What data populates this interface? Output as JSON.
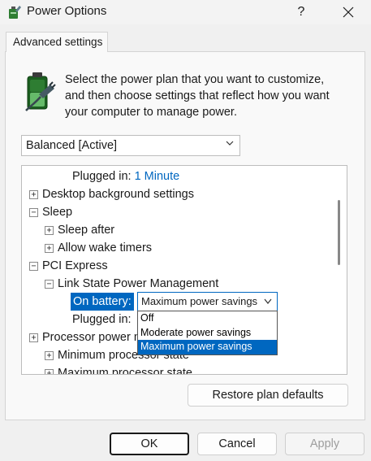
{
  "window": {
    "title": "Power Options",
    "help_label": "?",
    "close_label": "✕"
  },
  "tab": {
    "label": "Advanced settings"
  },
  "intro_text": "Select the power plan that you want to customize, and then choose settings that reflect how you want your computer to manage power.",
  "plan_select": {
    "value": "Balanced [Active]"
  },
  "tree": {
    "plugged_in_label": "Plugged in:",
    "plugged_in_value": "1 Minute",
    "desktop_background": "Desktop background settings",
    "sleep": "Sleep",
    "sleep_after": "Sleep after",
    "allow_wake_timers": "Allow wake timers",
    "pci_express": "PCI Express",
    "link_state": "Link State Power Management",
    "on_battery_label": "On battery:",
    "on_battery_value": "Maximum power savings",
    "plugged_in2_label": "Plugged in:",
    "processor_power": "Processor power m",
    "min_processor": "Minimum processor state",
    "max_processor": "Maximum processor state"
  },
  "dropdown": {
    "options": [
      "Off",
      "Moderate power savings",
      "Maximum power savings"
    ],
    "selected_index": 2
  },
  "buttons": {
    "restore": "Restore plan defaults",
    "ok": "OK",
    "cancel": "Cancel",
    "apply": "Apply"
  },
  "colors": {
    "accent": "#0067c0",
    "disabled_text": "#9d9d9d"
  },
  "icons": {
    "app": "power-options-icon",
    "battery": "battery-plug-icon",
    "expand": "plus-box-icon",
    "collapse": "minus-box-icon",
    "chevron": "chevron-down-icon"
  }
}
